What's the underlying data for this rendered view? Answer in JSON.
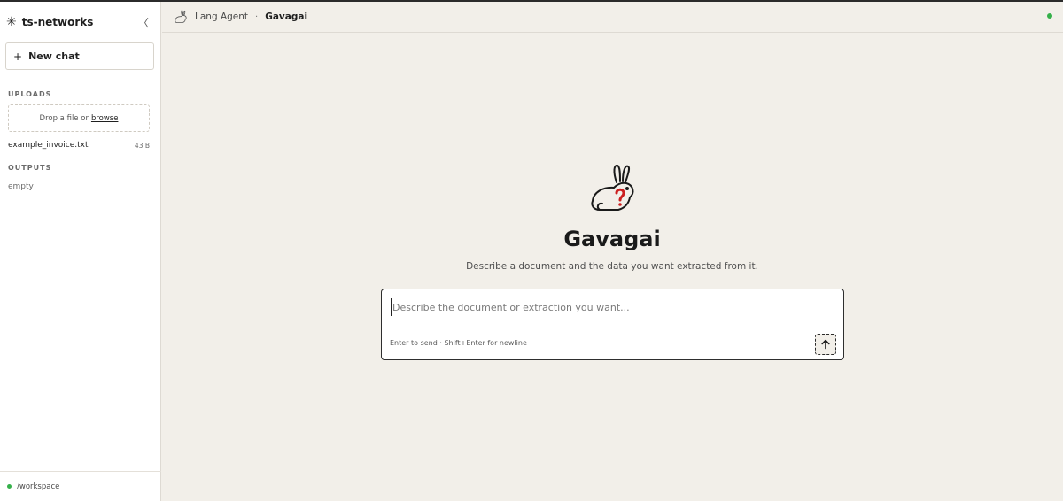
{
  "sidebar": {
    "brand": "ts-networks",
    "collapse_glyph": "〈",
    "new_chat_label": "New chat",
    "uploads_label": "UPLOADS",
    "drop_text": "Drop a file or",
    "browse_label": "browse",
    "files": [
      {
        "name": "example_invoice.txt",
        "size": "43 B"
      }
    ],
    "outputs_label": "OUTPUTS",
    "outputs_empty": "empty",
    "workspace_path": "/workspace"
  },
  "header": {
    "agent_name": "Lang Agent",
    "separator": "·",
    "page_name": "Gavagai",
    "status_color": "#35b04a"
  },
  "main": {
    "title": "Gavagai",
    "subtitle": "Describe a document and the data you want extracted from it.",
    "input_placeholder": "Describe the document or extraction you want...",
    "hint": "Enter to send · Shift+Enter for newline"
  },
  "icons": {
    "brand": "asterisk-icon",
    "header_logo": "rabbit-icon",
    "hero": "rabbit-question-icon",
    "send": "arrow-up-icon"
  },
  "colors": {
    "accent_red": "#cc1f1f",
    "status_green": "#35b04a",
    "background": "#f2efe9"
  }
}
